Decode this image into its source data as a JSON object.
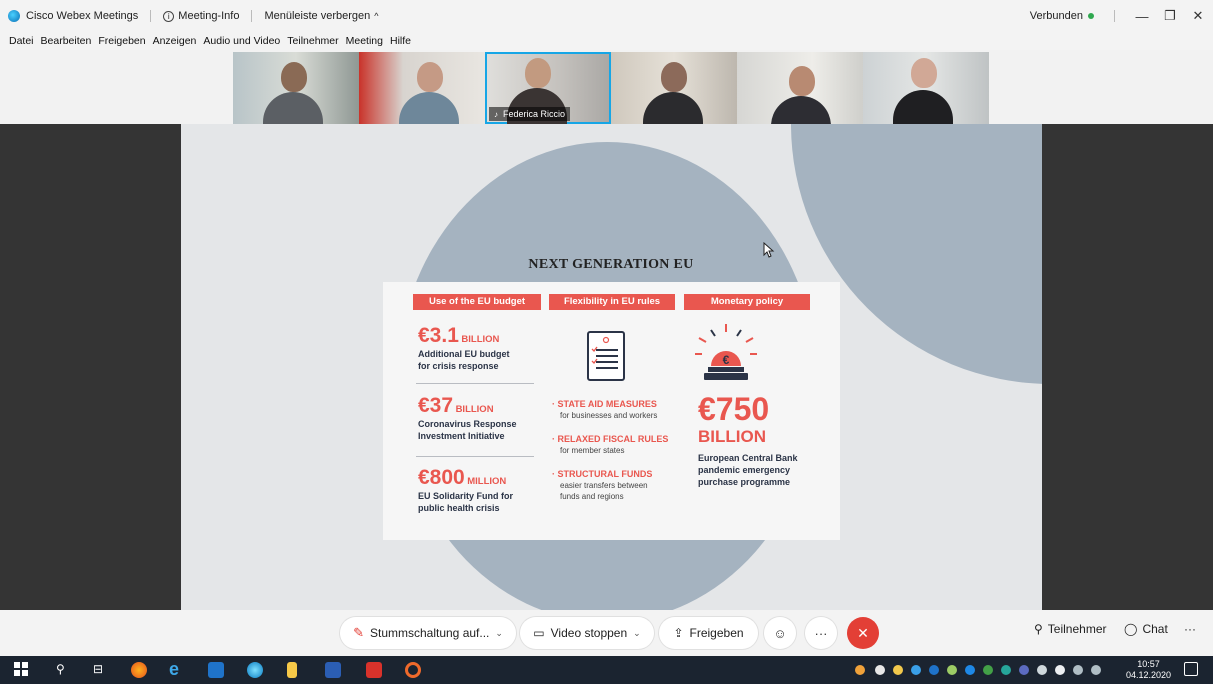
{
  "window": {
    "app_name": "Cisco Webex Meetings",
    "meeting_info": "Meeting-Info",
    "hide_menu": "Menüleiste verbergen",
    "status": "Verbunden",
    "colors": {
      "connected": "#2fa84f",
      "accent": "#e9574f",
      "active_speaker": "#16a6e6"
    }
  },
  "menu": {
    "items": [
      "Datei",
      "Bearbeiten",
      "Freigeben",
      "Anzeigen",
      "Audio und Video",
      "Teilnehmer",
      "Meeting",
      "Hilfe"
    ]
  },
  "videos": {
    "active_speaker_name": "Federica Riccio"
  },
  "slide": {
    "title": "NEXT GENERATION EU",
    "columns": [
      {
        "header": "Use of the EU budget"
      },
      {
        "header": "Flexibility in EU rules"
      },
      {
        "header": "Monetary policy"
      }
    ],
    "budget": [
      {
        "amount": "€3.1",
        "unit": "BILLION",
        "line1": "Additional EU budget",
        "line2": "for crisis response"
      },
      {
        "amount": "€37",
        "unit": "BILLION",
        "line1": "Coronavirus Response",
        "line2": "Investment Initiative"
      },
      {
        "amount": "€800",
        "unit": "MILLION",
        "line1": "EU Solidarity Fund for",
        "line2": "public health crisis"
      }
    ],
    "flexibility": [
      {
        "head": "STATE AID MEASURES",
        "line1": "for businesses and workers",
        "line2": ""
      },
      {
        "head": "RELAXED FISCAL RULES",
        "line1": "for member states",
        "line2": ""
      },
      {
        "head": "STRUCTURAL FUNDS",
        "line1": "easier transfers between",
        "line2": "funds and regions"
      }
    ],
    "monetary": {
      "amount": "€750",
      "unit": "BILLION",
      "line1": "European Central Bank",
      "line2": "pandemic emergency",
      "line3": "purchase programme"
    }
  },
  "controls": {
    "mute": "Stummschaltung auf...",
    "video": "Video stoppen",
    "share": "Freigeben",
    "participants": "Teilnehmer",
    "chat": "Chat"
  },
  "taskbar": {
    "time": "10:57",
    "date": "04.12.2020"
  }
}
